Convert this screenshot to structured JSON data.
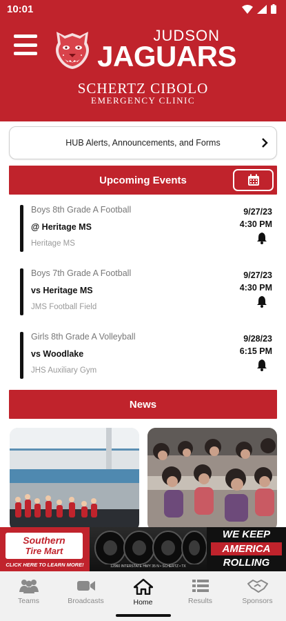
{
  "status_bar": {
    "time": "10:01"
  },
  "header": {
    "team_line1": "JUDSON",
    "team_line2": "JAGUARS",
    "sponsor_line1": "SCHERTZ  CIBOLO",
    "sponsor_line2": "EMERGENCY CLINIC",
    "brand_color": "#c0232c"
  },
  "hub": {
    "label": "HUB Alerts, Announcements, and Forms"
  },
  "upcoming": {
    "title": "Upcoming Events",
    "events": [
      {
        "category": "Boys 8th Grade A Football",
        "opponent": "@ Heritage MS",
        "location": "Heritage MS",
        "date": "9/27/23",
        "time": "4:30 PM"
      },
      {
        "category": "Boys 7th Grade A Football",
        "opponent": "vs Heritage MS",
        "location": "JMS Football Field",
        "date": "9/27/23",
        "time": "4:30 PM"
      },
      {
        "category": "Girls 8th Grade A Volleyball",
        "opponent": "vs Woodlake",
        "location": "JHS Auxiliary Gym",
        "date": "9/28/23",
        "time": "6:15 PM"
      }
    ]
  },
  "news": {
    "title": "News"
  },
  "ad": {
    "brand_line1": "Southern",
    "brand_line2": "Tire Mart",
    "cta": "CLICK HERE TO LEARN MORE!",
    "address": "12960 INTERSTATE HWY 35 N • SCHERTZ • TX",
    "slogan1": "WE KEEP",
    "slogan2": "AMERICA",
    "slogan3": "ROLLING"
  },
  "nav": {
    "items": [
      {
        "label": "Teams",
        "icon": "people-icon"
      },
      {
        "label": "Broadcasts",
        "icon": "video-camera-icon"
      },
      {
        "label": "Home",
        "icon": "home-icon"
      },
      {
        "label": "Results",
        "icon": "list-icon"
      },
      {
        "label": "Sponsors",
        "icon": "handshake-icon"
      }
    ],
    "active": "Home"
  }
}
